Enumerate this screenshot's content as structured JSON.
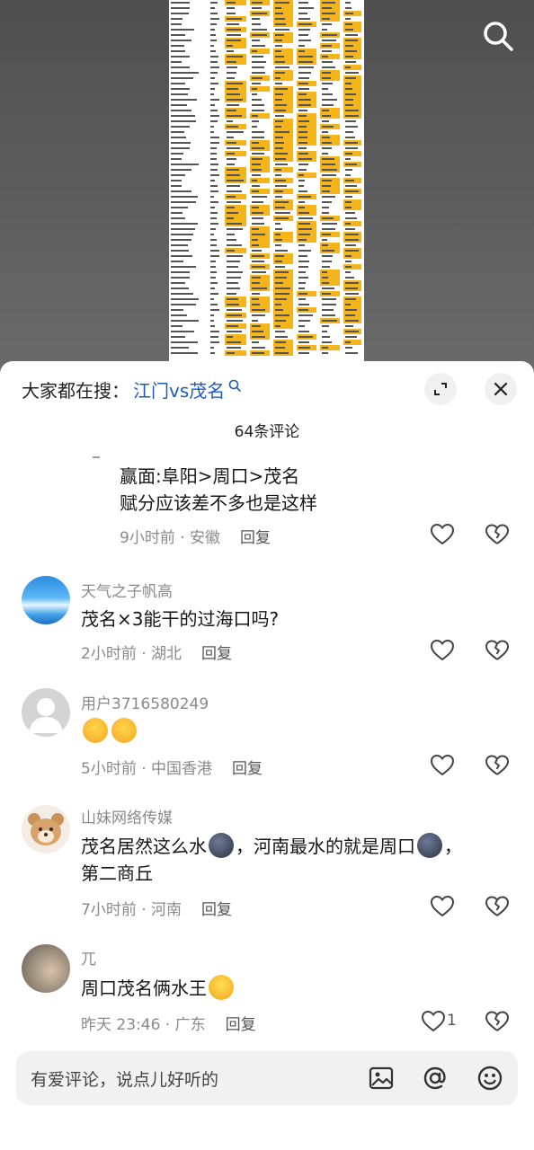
{
  "search": {
    "prefix": "大家都在搜：",
    "query": "江门vs茂名"
  },
  "comment_count": "64条评论",
  "comments": [
    {
      "username": "",
      "lines": [
        "赢面:阜阳>周口>茂名",
        "赋分应该差不多也是这样"
      ],
      "time_location": "9小时前 · 安徽",
      "reply": "回复",
      "likes": ""
    },
    {
      "username": "天气之子帆高",
      "lines": [
        "茂名×3能干的过海口吗?"
      ],
      "time_location": "2小时前 · 湖北",
      "reply": "回复",
      "likes": ""
    },
    {
      "username": "用户3716580249",
      "lines": [
        ""
      ],
      "time_location": "5小时前 · 中国香港",
      "reply": "回复",
      "likes": "",
      "emojis": [
        "crying-laugh-emoji",
        "crying-laugh-emoji"
      ]
    },
    {
      "username": "山妹网络传媒",
      "lines_parts": [
        "茂名居然这么水",
        "，河南最水的就是周口",
        "，",
        "第二商丘"
      ],
      "time_location": "7小时前 · 河南",
      "reply": "回复",
      "likes": ""
    },
    {
      "username": "兀",
      "lines": [
        "周口茂名俩水王"
      ],
      "time_location": "昨天 23:46 · 广东",
      "reply": "回复",
      "likes": "1"
    }
  ],
  "input": {
    "placeholder": "有爱评论，说点儿好听的"
  },
  "icons": {
    "search": "search-icon",
    "expand": "expand-icon",
    "close": "close-icon",
    "like": "heart-icon",
    "dislike": "broken-heart-icon",
    "image": "image-icon",
    "mention": "at-icon",
    "emoji": "emoji-icon"
  },
  "colors": {
    "link_blue": "#1e5bb8",
    "highlight_yellow": "#f5b41a"
  }
}
